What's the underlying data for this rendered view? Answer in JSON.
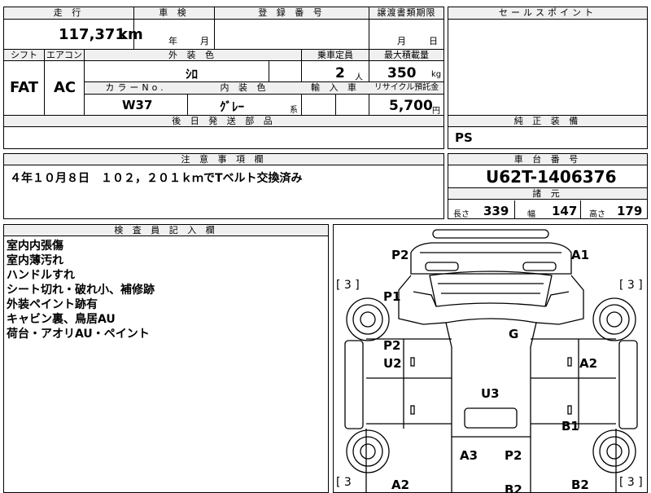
{
  "labels": {
    "mileage": "走 行",
    "inspection": "車 検",
    "registration": "登 録 番 号",
    "transfer_deadline": "譲渡書類期限",
    "sales_point": "セールスポイント",
    "shift": "シフト",
    "aircon": "エアコン",
    "exterior_color": "外 装 色",
    "capacity": "乗車定員",
    "max_load": "最大積載量",
    "color_no": "カラーNo.",
    "interior_color": "内 装 色",
    "import": "輸 入 車",
    "recycle_fee": "リサイクル預託金",
    "later_parts": "後 日 発 送 部 品",
    "genuine_equipment": "純 正 装 備",
    "notes": "注 意 事 項 欄",
    "chassis_no": "車 台 番 号",
    "specs": "諸 元",
    "inspector_notes": "検 査 員 記 入 欄"
  },
  "values": {
    "mileage": "117,371",
    "mileage_unit": "km",
    "inspection_year": "年",
    "inspection_month": "月",
    "transfer_month": "月",
    "transfer_day": "日",
    "shift": "FAT",
    "aircon": "AC",
    "exterior_color": "ｼﾛ",
    "capacity": "2",
    "capacity_unit": "人",
    "max_load": "350",
    "max_load_unit": "kg",
    "color_no": "W37",
    "interior_color": "ｸﾞﾚｰ",
    "interior_suffix": "系",
    "recycle_fee": "5,700",
    "recycle_unit": "円",
    "genuine_equipment": "PS",
    "notes_text": "４年１０月８日　１０２，２０１ｋｍでTベルト交換済み",
    "chassis_no": "U62T-1406376",
    "length_label": "長さ",
    "length": "339",
    "width_label": "幅",
    "width": "147",
    "height_label": "高さ",
    "height": "179"
  },
  "inspector_lines": [
    "室内内張傷",
    "室内薄汚れ",
    "ハンドルすれ",
    "シート切れ・破れ小、補修跡",
    "外装ペイント跡有",
    "キャビン裏、鳥居AU",
    "荷台・アオリAU・ペイント"
  ],
  "diagram": {
    "marks": {
      "p2_top": "P2",
      "a1": "A1",
      "p1": "P1",
      "g": "G",
      "p2_left": "P2",
      "u2": "U2",
      "a2_right": "A2",
      "u3": "U3",
      "b1": "B1",
      "a3": "A3",
      "p2_bottom": "P2",
      "a2_bottom": "A2",
      "b2_bottom": "B2",
      "b2_right": "B2"
    },
    "tire_tl": "[ 3 ]",
    "tire_tr": "[ 3 ]",
    "tire_bl": "[ 3",
    "tire_br": "[ 3 ]"
  }
}
